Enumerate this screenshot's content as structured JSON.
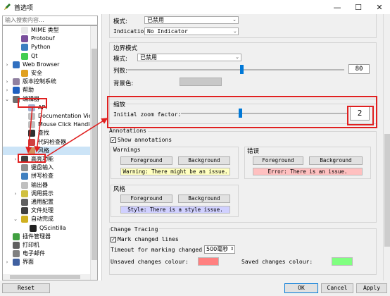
{
  "window": {
    "title": "首选项",
    "minimize": "—",
    "maximize": "☐",
    "close": "✕"
  },
  "search": {
    "placeholder": "输入搜索内容..."
  },
  "tree": {
    "items": [
      {
        "label": "MIME 类型",
        "icon_color": "#e8e8e8"
      },
      {
        "label": "Protobuf",
        "icon_color": "#7a4f9c"
      },
      {
        "label": "Python",
        "icon_color": "#3b7ec0"
      },
      {
        "label": "Qt",
        "icon_color": "#41cd52"
      },
      {
        "label": "Web Browser",
        "icon_color": "#3070c0"
      },
      {
        "label": "安全",
        "icon_color": "#e0a020"
      },
      {
        "label": "版本控制系统",
        "icon_color": "#9080a0"
      },
      {
        "label": "帮助",
        "icon_color": "#2060c0"
      },
      {
        "label": "编辑器",
        "icon_color": "#707070"
      },
      {
        "label": "API",
        "icon_color": "#a0b0d0"
      },
      {
        "label": "Documentation Viewer",
        "icon_color": "#c0c0c0"
      },
      {
        "label": "Mouse Click Handlers",
        "icon_color": "#c0c0c0"
      },
      {
        "label": "查找",
        "icon_color": "#303030"
      },
      {
        "label": "代码检查器",
        "icon_color": "#d04040"
      },
      {
        "label": "风格",
        "icon_color": "#d09060"
      },
      {
        "label": "高亮功能",
        "icon_color": "#404040"
      },
      {
        "label": "键盘输入",
        "icon_color": "#909090"
      },
      {
        "label": "拼写检查",
        "icon_color": "#4080c0"
      },
      {
        "label": "输出器",
        "icon_color": "#c0c0c0"
      },
      {
        "label": "调用提示",
        "icon_color": "#d0c040"
      },
      {
        "label": "通用配置",
        "icon_color": "#606060"
      },
      {
        "label": "文件处理",
        "icon_color": "#404040"
      },
      {
        "label": "自动完成",
        "icon_color": "#d0b020"
      },
      {
        "label": "QScintilla",
        "icon_color": "#202020"
      },
      {
        "label": "插件管理器",
        "icon_color": "#40a040"
      },
      {
        "label": "打印机",
        "icon_color": "#606060"
      },
      {
        "label": "电子邮件",
        "icon_color": "#808080"
      },
      {
        "label": "界面",
        "icon_color": "#4060a0"
      }
    ]
  },
  "panel": {
    "mode_label": "模式:",
    "mode_value": "已禁用",
    "indication_label": "Indication:",
    "indication_value": "No Indicator",
    "edge_mode_title": "边界模式",
    "edge_mode_label": "模式:",
    "edge_mode_value": "已禁用",
    "column_label": "列数:",
    "column_value": "80",
    "bg_color_label": "背景色:",
    "zoom_title": "缩放",
    "zoom_label": "Initial zoom factor:",
    "zoom_value": "2",
    "annotations_title": "Annotations",
    "show_annotations": "Show annotations",
    "warnings_title": "Warnings",
    "errors_title": "错误",
    "style_title": "风格",
    "fg_label": "Foreground",
    "bg_label": "Background",
    "warning_preview": "Warning: There might be an issue.",
    "error_preview": "Error: There is an issue.",
    "style_preview": "Style: There is a style issue.",
    "change_tracing_title": "Change Tracing",
    "mark_changed": "Mark changed lines",
    "timeout_label": "Timeout for marking changed lines:",
    "timeout_value": "500毫秒",
    "unsaved_label": "Unsaved changes colour:",
    "saved_label": "Saved changes colour:"
  },
  "colors": {
    "warning_bg": "#ffffc0",
    "error_bg": "#ffc0c0",
    "style_bg": "#d0d0ff",
    "unsaved": "#ff8080",
    "saved": "#80ff80",
    "annotation": "#e02020"
  },
  "buttons": {
    "reset": "Reset",
    "ok": "OK",
    "cancel": "Cancel",
    "apply": "Apply"
  }
}
